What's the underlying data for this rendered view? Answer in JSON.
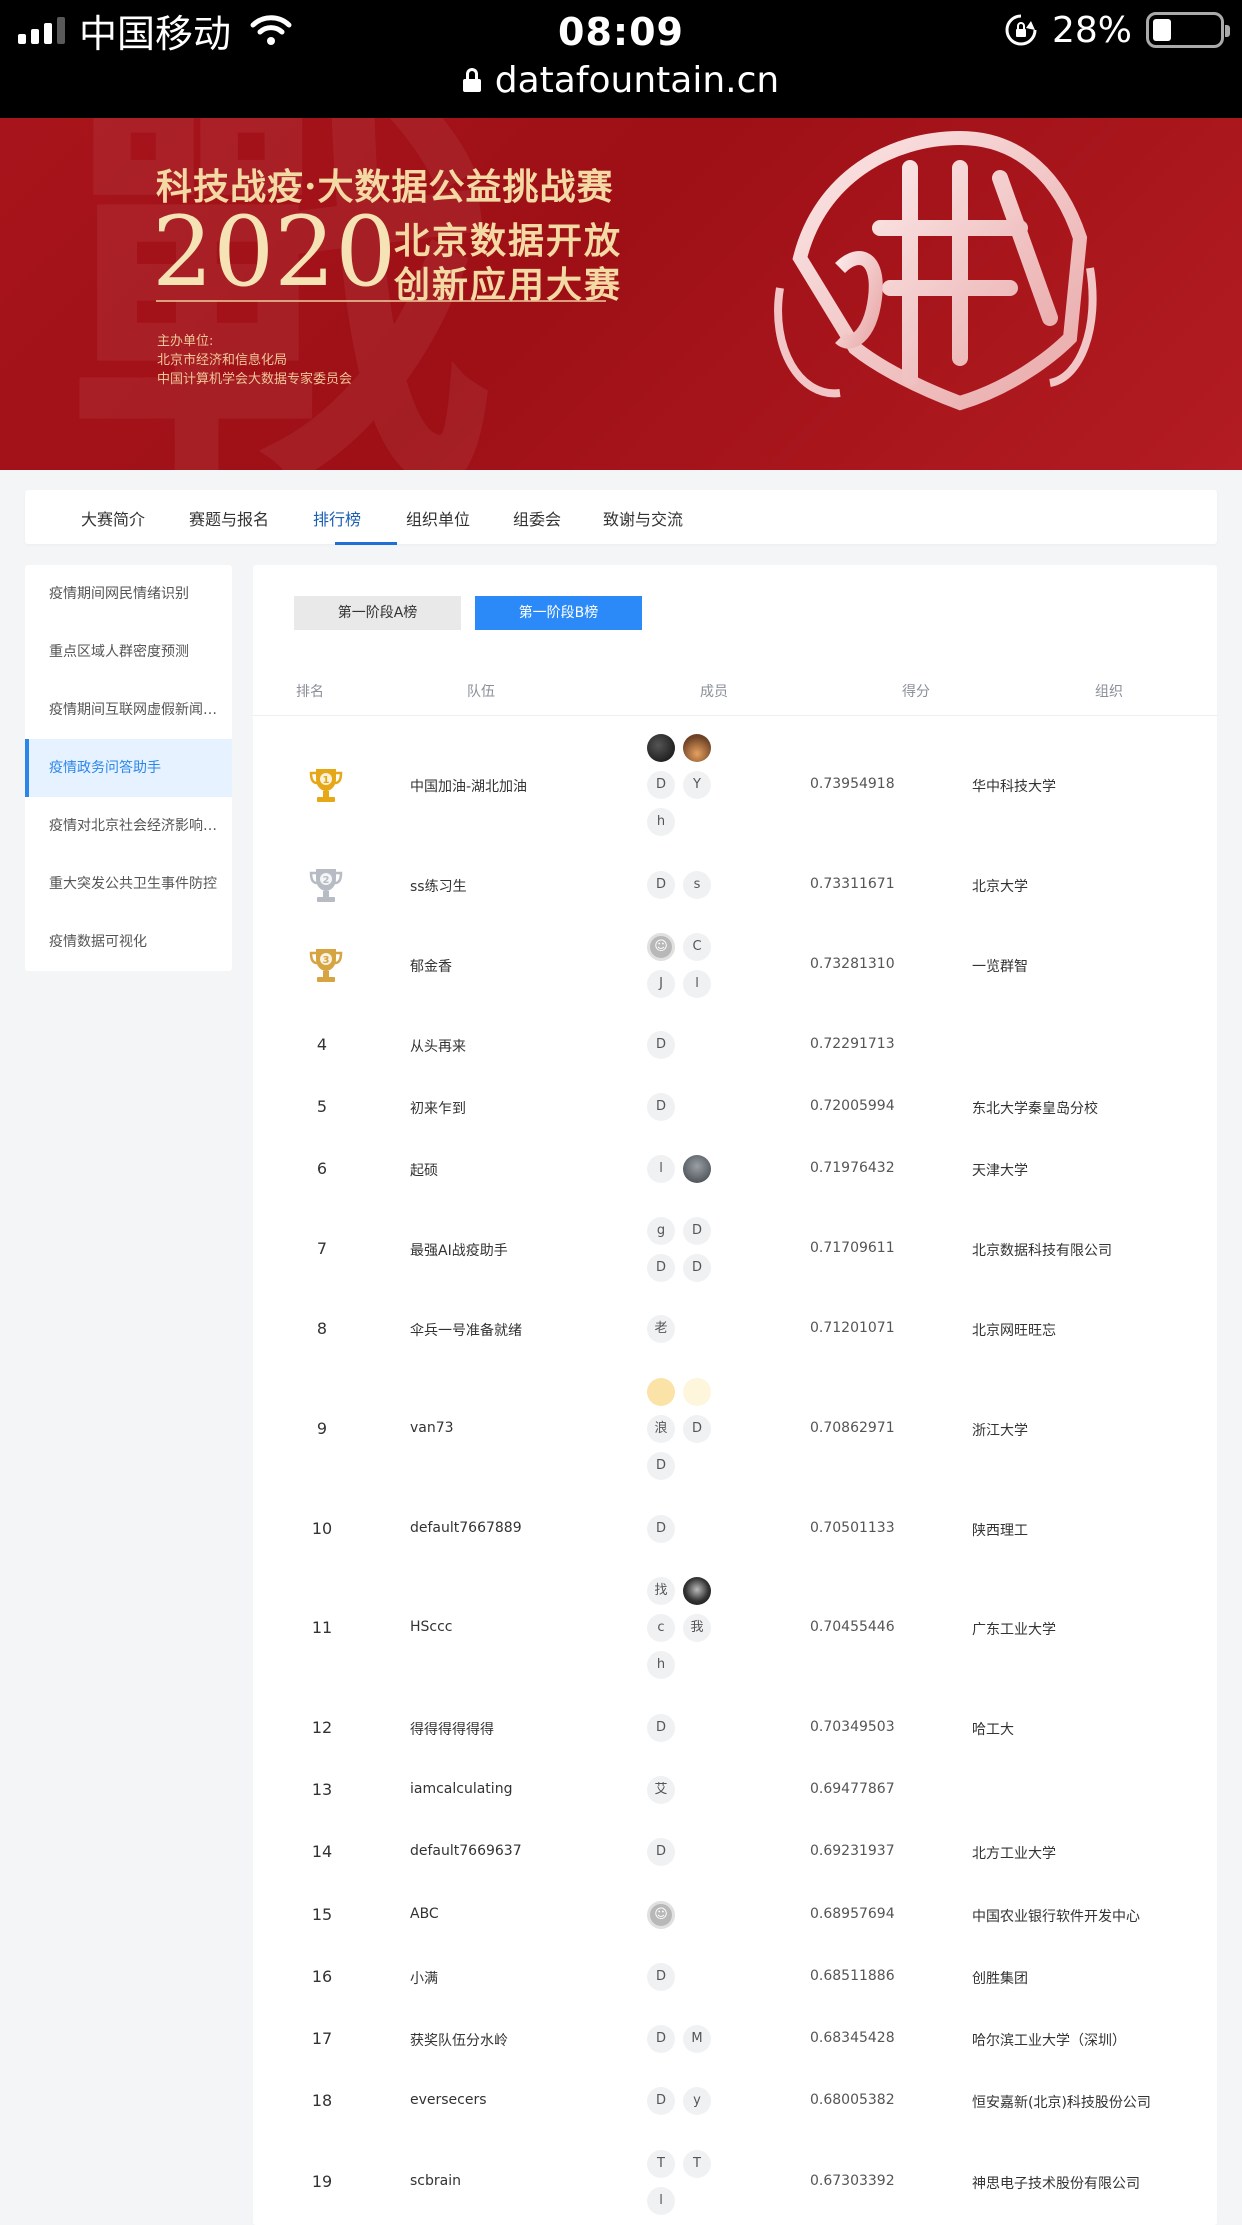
{
  "status": {
    "carrier": "中国移动",
    "time": "08:09",
    "battery": "28%",
    "url": "datafountain.cn"
  },
  "banner": {
    "line1": "科技战疫·大数据公益挑战赛",
    "year": "2020",
    "sub1": "北京数据开放",
    "sub2": "创新应用大赛",
    "org_label": "主办单位:",
    "org1": "北京市经济和信息化局",
    "org2": "中国计算机学会大数据专家委员会"
  },
  "nav": {
    "tabs": [
      "大赛简介",
      "赛题与报名",
      "排行榜",
      "组织单位",
      "组委会",
      "致谢与交流"
    ],
    "active": "排行榜"
  },
  "sidebar": {
    "items": [
      "疫情期间网民情绪识别",
      "重点区域人群密度预测",
      "疫情期间互联网虚假新闻检测",
      "疫情政务问答助手",
      "疫情对北京社会经济影响预测",
      "重大突发公共卫生事件防控",
      "疫情数据可视化"
    ],
    "active_index": 3
  },
  "leaderboard": {
    "stage_a": "第一阶段A榜",
    "stage_b": "第一阶段B榜",
    "headers": {
      "rank": "排名",
      "team": "队伍",
      "members": "成员",
      "score": "得分",
      "org": "组织"
    },
    "rows": [
      {
        "rank": "1",
        "team": "中国加油-湖北加油",
        "members": [
          "",
          "",
          "D",
          "Y",
          "h"
        ],
        "score": "0.73954918",
        "org": "华中科技大学"
      },
      {
        "rank": "2",
        "team": "ss练习生",
        "members": [
          "D",
          "s"
        ],
        "score": "0.73311671",
        "org": "北京大学"
      },
      {
        "rank": "3",
        "team": "郁金香",
        "members": [
          "",
          "C",
          "J",
          "l"
        ],
        "score": "0.73281310",
        "org": "一览群智"
      },
      {
        "rank": "4",
        "team": "从头再来",
        "members": [
          "D"
        ],
        "score": "0.72291713",
        "org": ""
      },
      {
        "rank": "5",
        "team": "初来乍到",
        "members": [
          "D"
        ],
        "score": "0.72005994",
        "org": "东北大学秦皇岛分校"
      },
      {
        "rank": "6",
        "team": "起硕",
        "members": [
          "l",
          ""
        ],
        "score": "0.71976432",
        "org": "天津大学"
      },
      {
        "rank": "7",
        "team": "最强AI战疫助手",
        "members": [
          "g",
          "D",
          "D",
          "D"
        ],
        "score": "0.71709611",
        "org": "北京数据科技有限公司"
      },
      {
        "rank": "8",
        "team": "伞兵一号准备就绪",
        "members": [
          "老"
        ],
        "score": "0.71201071",
        "org": "北京网旺旺忘"
      },
      {
        "rank": "9",
        "team": "van73",
        "members": [
          "",
          "",
          "浪",
          "D",
          "D"
        ],
        "score": "0.70862971",
        "org": "浙江大学"
      },
      {
        "rank": "10",
        "team": "default7667889",
        "members": [
          "D"
        ],
        "score": "0.70501133",
        "org": "陕西理工"
      },
      {
        "rank": "11",
        "team": "HSccc",
        "members": [
          "找",
          "",
          "c",
          "我",
          "h"
        ],
        "score": "0.70455446",
        "org": "广东工业大学"
      },
      {
        "rank": "12",
        "team": "得得得得得得",
        "members": [
          "D"
        ],
        "score": "0.70349503",
        "org": "哈工大"
      },
      {
        "rank": "13",
        "team": "iamcalculating",
        "members": [
          "艾"
        ],
        "score": "0.69477867",
        "org": ""
      },
      {
        "rank": "14",
        "team": "default7669637",
        "members": [
          "D"
        ],
        "score": "0.69231937",
        "org": "北方工业大学"
      },
      {
        "rank": "15",
        "team": "ABC",
        "members": [
          ""
        ],
        "score": "0.68957694",
        "org": "中国农业银行软件开发中心"
      },
      {
        "rank": "16",
        "team": "小满",
        "members": [
          "D"
        ],
        "score": "0.68511886",
        "org": "创胜集团"
      },
      {
        "rank": "17",
        "team": "获奖队伍分水岭",
        "members": [
          "D",
          "M"
        ],
        "score": "0.68345428",
        "org": "哈尔滨工业大学（深圳）"
      },
      {
        "rank": "18",
        "team": "eversecers",
        "members": [
          "D",
          "y"
        ],
        "score": "0.68005382",
        "org": "恒安嘉新(北京)科技股份公司"
      },
      {
        "rank": "19",
        "team": "scbrain",
        "members": [
          "T",
          "T",
          "l"
        ],
        "score": "0.67303392",
        "org": "神思电子技术股份有限公司"
      }
    ]
  }
}
